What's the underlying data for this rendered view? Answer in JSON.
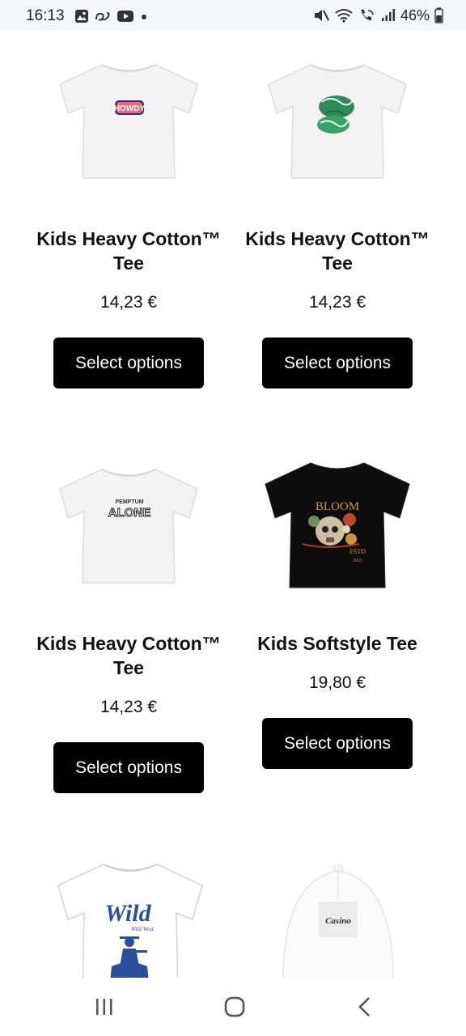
{
  "status_bar": {
    "time": "16:13",
    "battery": "46%",
    "left_icons": [
      "gallery-icon",
      "link-icon",
      "youtube-icon",
      "dot-icon"
    ],
    "right_icons": [
      "mute-icon",
      "wifi-icon",
      "wifi-calling-icon",
      "signal-icon",
      "battery-icon"
    ]
  },
  "products": [
    {
      "title": "Kids Heavy Cotton™ Tee",
      "price": "14,23 €",
      "button": "Select options",
      "image": "white-tshirt-howdy-print",
      "print_text": "HOWDY"
    },
    {
      "title": "Kids Heavy Cotton™ Tee",
      "price": "14,23 €",
      "button": "Select options",
      "image": "white-tshirt-green-script-print"
    },
    {
      "title": "Kids Heavy Cotton™ Tee",
      "price": "14,23 €",
      "button": "Select options",
      "image": "white-tshirt-alone-print",
      "print_text": "ALONE",
      "print_subtext": "PEMPTUM"
    },
    {
      "title": "Kids Softstyle Tee",
      "price": "19,80 €",
      "button": "Select options",
      "image": "black-tshirt-bloom-skull-print",
      "print_text": "BLOOM",
      "print_subtext": "ESTD",
      "print_year": "2021"
    },
    {
      "image": "white-tshirt-wild-cowboy-print",
      "print_text": "Wild",
      "print_subtext": "Wild West"
    },
    {
      "image": "white-cap-casino-print",
      "print_text": "Casino"
    }
  ],
  "nav_bar": {
    "recents": "recents-icon",
    "home": "home-icon",
    "back": "back-icon"
  },
  "colors": {
    "button_bg": "#000000",
    "button_text": "#ffffff",
    "status_bar_bg": "#f4f7fb",
    "page_bg": "#ffffff"
  }
}
